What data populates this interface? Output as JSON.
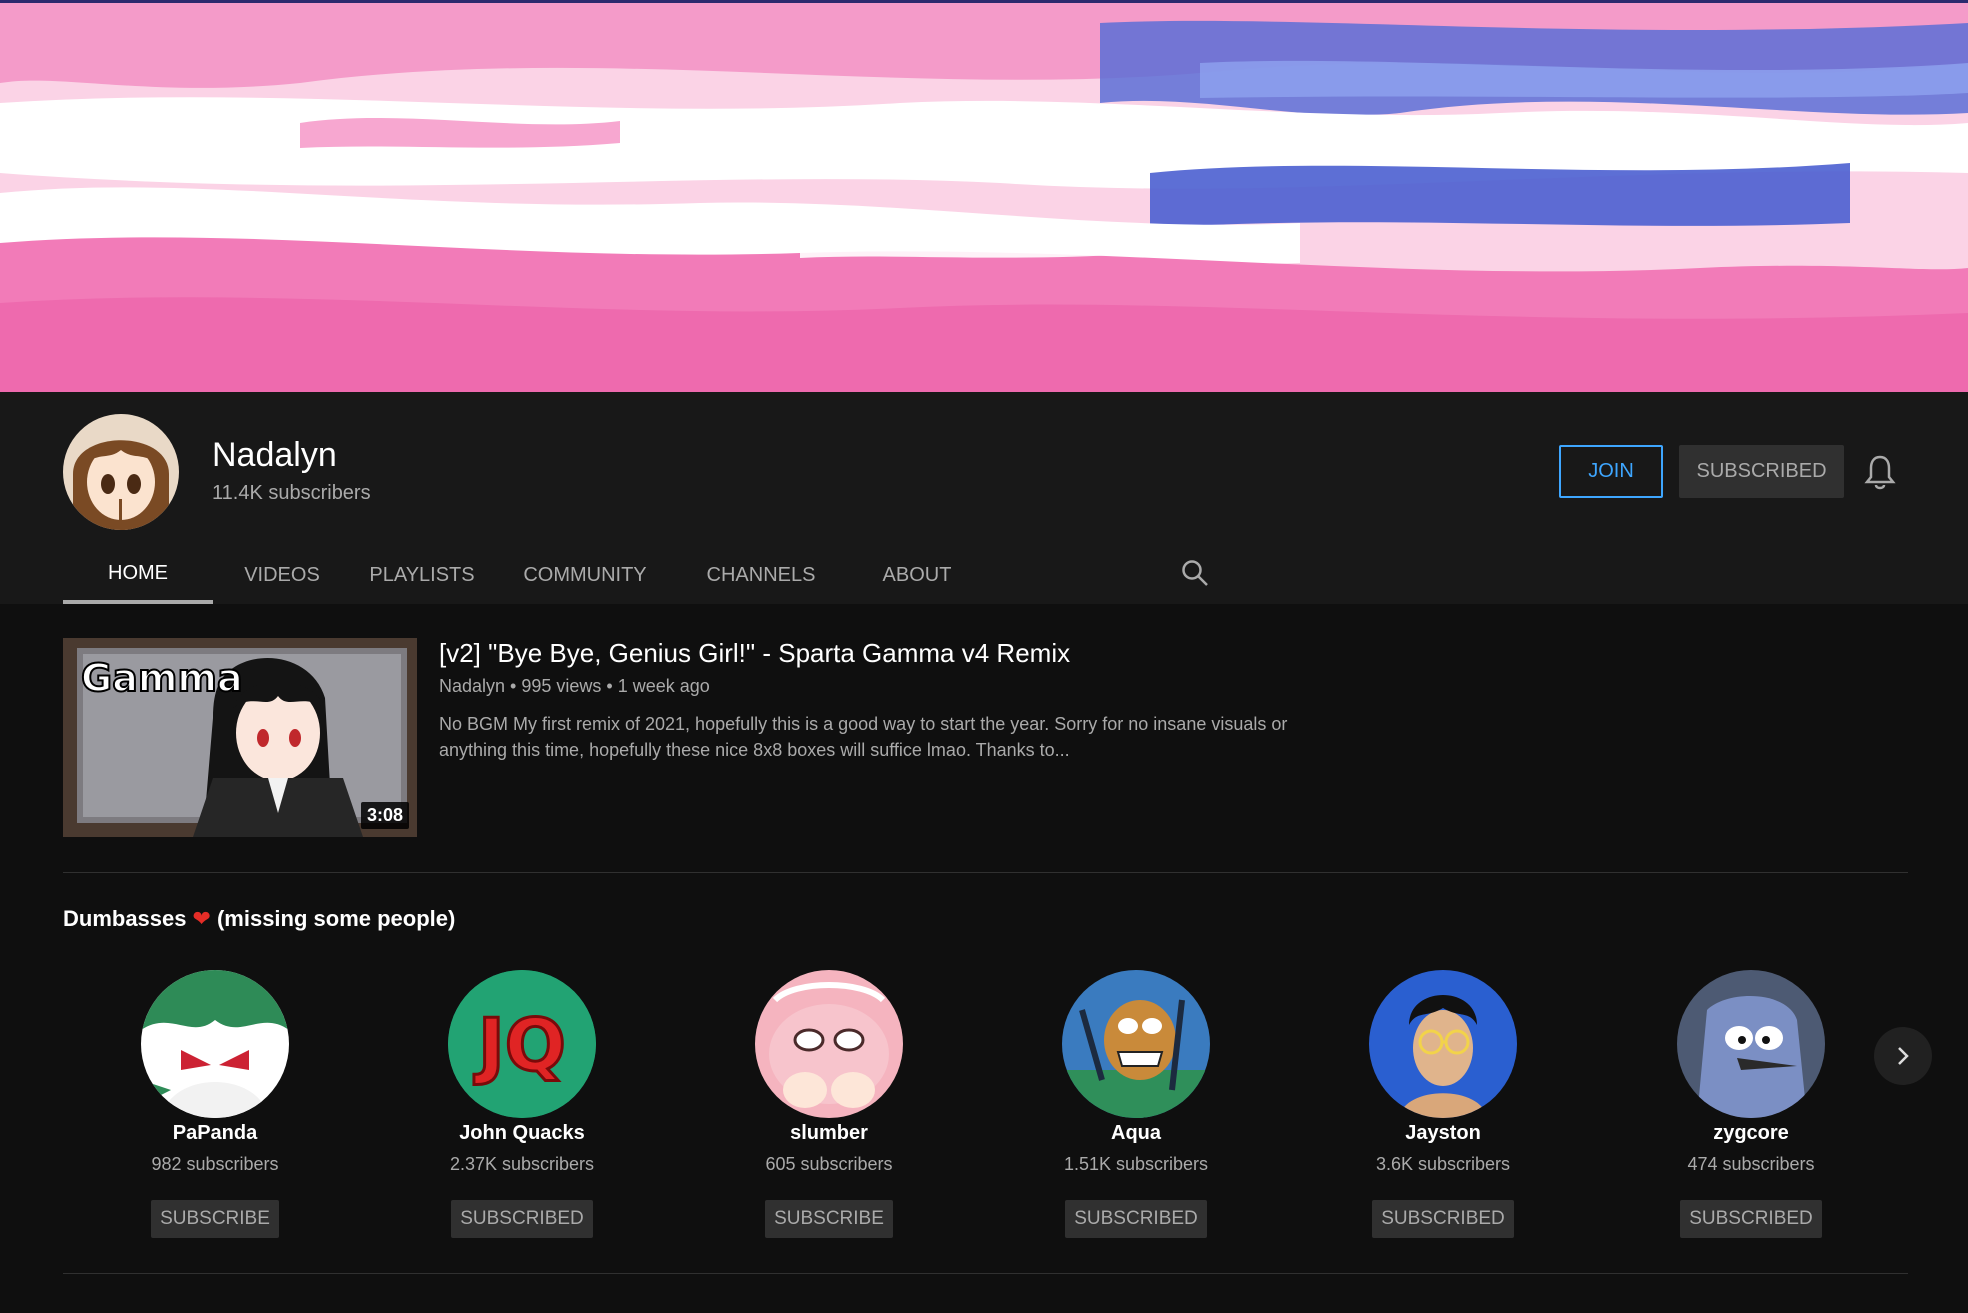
{
  "channel": {
    "name": "Nadalyn",
    "subscribers": "11.4K subscribers",
    "join_label": "JOIN",
    "subscribed_label": "SUBSCRIBED"
  },
  "tabs": [
    {
      "label": "HOME",
      "active": true
    },
    {
      "label": "VIDEOS",
      "active": false
    },
    {
      "label": "PLAYLISTS",
      "active": false
    },
    {
      "label": "COMMUNITY",
      "active": false
    },
    {
      "label": "CHANNELS",
      "active": false
    },
    {
      "label": "ABOUT",
      "active": false
    }
  ],
  "featured_video": {
    "title": "[v2] \"Bye Bye, Genius Girl!\" - Sparta Gamma v4 Remix",
    "meta": "Nadalyn • 995 views • 1 week ago",
    "description": "No BGM My first remix of 2021, hopefully this is a good way to start the year. Sorry for no insane visuals or anything this time, hopefully these nice 8x8 boxes will suffice lmao. Thanks to...",
    "duration": "3:08",
    "thumb_text": "Gamma"
  },
  "section": {
    "title_before": "Dumbasses",
    "title_after": "(missing some people)"
  },
  "channels": [
    {
      "name": "PaPanda",
      "subscribers": "982 subscribers",
      "button": "SUBSCRIBE",
      "color": "#2e8b57"
    },
    {
      "name": "John Quacks",
      "subscribers": "2.37K subscribers",
      "button": "SUBSCRIBED",
      "color": "#1f9e6e"
    },
    {
      "name": "slumber",
      "subscribers": "605 subscribers",
      "button": "SUBSCRIBE",
      "color": "#f2a7b6"
    },
    {
      "name": "Aqua",
      "subscribers": "1.51K subscribers",
      "button": "SUBSCRIBED",
      "color": "#3a7bbf"
    },
    {
      "name": "Jayston",
      "subscribers": "3.6K subscribers",
      "button": "SUBSCRIBED",
      "color": "#2a5fd0"
    },
    {
      "name": "zygcore",
      "subscribers": "474 subscribers",
      "button": "SUBSCRIBED",
      "color": "#7b8aa8"
    }
  ],
  "icons": {
    "bell": "bell-icon",
    "search": "search-icon",
    "next": "chevron-right-icon",
    "heart": "heart-icon"
  },
  "colors": {
    "accent": "#3ea6ff",
    "background": "#0f0f0f",
    "header": "#181818",
    "heart": "#e52d27"
  }
}
